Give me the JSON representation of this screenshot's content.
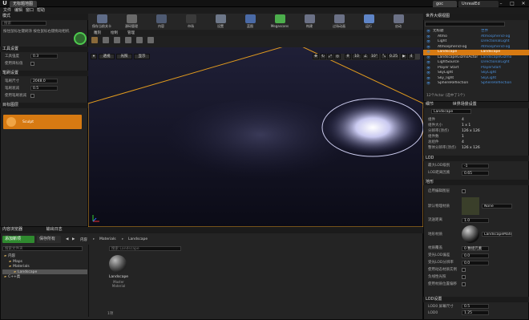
{
  "title_tab": "无标题地图",
  "right_tabs": [
    "goc",
    "UnrealEd"
  ],
  "menu": [
    "文件",
    "编辑",
    "窗口",
    "帮助"
  ],
  "modes": {
    "title": "模式",
    "search_placeholder": "搜索",
    "hint": "按住鼠标左键刷涂 按住鼠标右键拖动相机",
    "tool_settings": "工具设置",
    "tool_rows": [
      {
        "label": "工具强度",
        "value": "0.3"
      },
      {
        "label": "使用目标值",
        "value": ""
      }
    ],
    "brush_settings": "笔刷设置",
    "brush_rows": [
      {
        "label": "笔刷尺寸",
        "value": "2048.0"
      },
      {
        "label": "笔刷衰减",
        "value": "0.5"
      },
      {
        "label": "使用笔刷衰减",
        "value": ""
      }
    ],
    "target_layers": "目标图层",
    "heightmap_item": "Sculpt"
  },
  "toolbar": [
    {
      "label": "保存当前关卡",
      "icon": "save-icon",
      "color": "#5f6c88"
    },
    {
      "label": "源码管理",
      "icon": "source-control-icon",
      "color": "#6a6a6a"
    },
    {
      "label": "内容",
      "icon": "content-icon",
      "color": "#4e5a72"
    },
    {
      "label": "市场",
      "icon": "market-icon",
      "color": "#3a3a3a"
    },
    {
      "label": "设置",
      "icon": "settings-icon",
      "color": "#6d7789"
    },
    {
      "label": "蓝图",
      "icon": "blueprint-icon",
      "color": "#4a6aa6"
    },
    {
      "label": "Megascans",
      "icon": "megascans-icon",
      "color": "#4cae4c"
    },
    {
      "label": "构建",
      "icon": "build-icon",
      "color": "#6b7186"
    },
    {
      "label": "过场动画",
      "icon": "cinematics-icon",
      "color": "#6b7186"
    },
    {
      "label": "运行",
      "icon": "play-icon",
      "color": "#5f85c7"
    },
    {
      "label": "启动",
      "icon": "launch-icon",
      "color": "#6b7186"
    }
  ],
  "mode_tabs": [
    "雕刻",
    "绘制",
    "管理"
  ],
  "viewport": {
    "perspective": "透视",
    "lit": "光照",
    "display": "显示",
    "right_values": [
      "10",
      "10°",
      "0.25",
      "4"
    ]
  },
  "outliner": {
    "title": "世界大纲视图",
    "items": [
      {
        "name": "无标题",
        "type": "世界"
      },
      {
        "name": "Atmo",
        "type": "AtmosphericFog"
      },
      {
        "name": "Light",
        "type": "DirectionalLight"
      },
      {
        "name": "AtmosphericFog",
        "type": "AtmosphericFog"
      },
      {
        "name": "Landscape",
        "type": "Landscape"
      },
      {
        "name": "LandscapeGizmoActor",
        "type": "LandscapeGizmo"
      },
      {
        "name": "LightSource",
        "type": "DirectionalLight"
      },
      {
        "name": "Player Start",
        "type": "PlayerStart"
      },
      {
        "name": "SkyLight",
        "type": "SkyLight"
      },
      {
        "name": "Sky_light",
        "type": "SkyLight"
      },
      {
        "name": "SphereReflection",
        "type": "SphereReflection"
      }
    ],
    "footer": "12个Actor (选中了1个)"
  },
  "details": {
    "tabs": [
      "细节",
      "世界场景设置"
    ],
    "name_value": "Landscape",
    "info_rows": [
      {
        "label": "组件",
        "value": "4"
      },
      {
        "label": "组件大小",
        "value": "1 x 1"
      },
      {
        "label": "分辨率(顶点)",
        "value": "126 x 126"
      },
      {
        "label": "组件数",
        "value": "1"
      },
      {
        "label": "总组件",
        "value": "4"
      },
      {
        "label": "整体分辨率(顶点)",
        "value": "126 x 126"
      }
    ],
    "lod_header": "LOD",
    "lod_rows": [
      {
        "label": "最大LOD级别",
        "value": "-1"
      },
      {
        "label": "LOD距离因素",
        "value": "0.65"
      }
    ],
    "landscape_header": "地形",
    "landscape_rows": [
      {
        "label": "启用编辑图层",
        "value": ""
      },
      {
        "label": "默认物理材质",
        "value": "None"
      },
      {
        "label": "流送距离",
        "value": "1.0"
      },
      {
        "label": "地形材质",
        "value": "LandscapeMaterial"
      },
      {
        "label": "材质覆盖",
        "value": "0 数组元素"
      },
      {
        "label": "受光LOD偏差",
        "value": "0.0"
      },
      {
        "label": "受光LOD分辨率",
        "value": "0.0"
      },
      {
        "label": "使用动态材质实例",
        "value": ""
      },
      {
        "label": "负线性光照",
        "value": ""
      },
      {
        "label": "使用材质位置偏移",
        "value": ""
      }
    ],
    "lod_settings_header": "LOD设置",
    "lod_settings_rows": [
      {
        "label": "LOD0 屏幕尺寸",
        "value": "0.5"
      },
      {
        "label": "LOD0",
        "value": "1.25"
      }
    ]
  },
  "content_browser": {
    "tabs": [
      "内容浏览器",
      "输出日志"
    ],
    "add_new": "添加新项",
    "save_all": "保存所有",
    "path": [
      "内容",
      "Materials",
      "Landscape"
    ],
    "search_placeholder": "搜索文件夹",
    "filter_search": "搜索 Landscape",
    "tree": [
      {
        "name": "内容",
        "depth": 0
      },
      {
        "name": "Maps",
        "depth": 1
      },
      {
        "name": "Materials",
        "depth": 1
      },
      {
        "name": "Landscape",
        "depth": 2
      },
      {
        "name": "C++类",
        "depth": 0
      }
    ],
    "asset_name": "Landscape",
    "asset_type": "Master Material",
    "status": "1项"
  }
}
